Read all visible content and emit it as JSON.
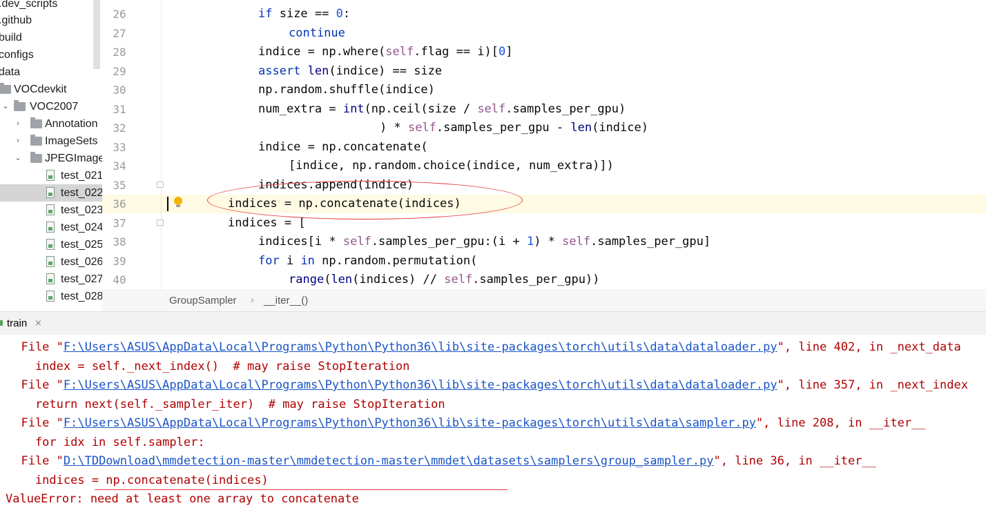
{
  "project_tree": {
    "items": [
      {
        "label": ".dev_scripts",
        "type": "folder",
        "arrow": ""
      },
      {
        "label": ".github",
        "type": "folder",
        "arrow": ""
      },
      {
        "label": "build",
        "type": "folder",
        "arrow": ""
      },
      {
        "label": "configs",
        "type": "folder",
        "arrow": ""
      },
      {
        "label": "data",
        "type": "folder",
        "arrow": ""
      },
      {
        "label": "VOCdevkit",
        "type": "folder",
        "arrow": ""
      },
      {
        "label": "VOC2007",
        "type": "folder",
        "arrow": "expanded"
      },
      {
        "label": "Annotation",
        "type": "folder",
        "arrow": "collapsed"
      },
      {
        "label": "ImageSets",
        "type": "folder",
        "arrow": "collapsed"
      },
      {
        "label": "JPEGImages",
        "type": "folder",
        "arrow": "expanded"
      },
      {
        "label": "test_021",
        "type": "file"
      },
      {
        "label": "test_022",
        "type": "file",
        "selected": true
      },
      {
        "label": "test_023",
        "type": "file"
      },
      {
        "label": "test_024",
        "type": "file"
      },
      {
        "label": "test_025",
        "type": "file"
      },
      {
        "label": "test_026",
        "type": "file"
      },
      {
        "label": "test_027",
        "type": "file"
      },
      {
        "label": "test_028",
        "type": "file"
      }
    ]
  },
  "editor": {
    "line_numbers": [
      "26",
      "27",
      "28",
      "29",
      "30",
      "31",
      "32",
      "33",
      "34",
      "35",
      "36",
      "37",
      "38",
      "39",
      "40"
    ],
    "current_line": "36",
    "tokens": [
      [
        [
          "kw",
          "if"
        ],
        [
          "t",
          " size == "
        ],
        [
          "num",
          "0"
        ],
        [
          "t",
          ":"
        ]
      ],
      [
        [
          "kw",
          "continue"
        ]
      ],
      [
        [
          "t",
          "indice = np.where("
        ],
        [
          "self",
          "self"
        ],
        [
          "t",
          ".flag == i)["
        ],
        [
          "num",
          "0"
        ],
        [
          "t",
          "]"
        ]
      ],
      [
        [
          "kw",
          "assert "
        ],
        [
          "bi",
          "len"
        ],
        [
          "t",
          "(indice) == size"
        ]
      ],
      [
        [
          "t",
          "np.random.shuffle(indice)"
        ]
      ],
      [
        [
          "t",
          "num_extra = "
        ],
        [
          "bi",
          "int"
        ],
        [
          "t",
          "(np.ceil(size / "
        ],
        [
          "self",
          "self"
        ],
        [
          "t",
          ".samples_per_gpu)"
        ]
      ],
      [
        [
          "t",
          ") * "
        ],
        [
          "self",
          "self"
        ],
        [
          "t",
          ".samples_per_gpu - "
        ],
        [
          "bi",
          "len"
        ],
        [
          "t",
          "(indice)"
        ]
      ],
      [
        [
          "t",
          "indice = np.concatenate("
        ]
      ],
      [
        [
          "t",
          "[indice, np.random.choice(indice, num_extra)])"
        ]
      ],
      [
        [
          "t",
          "indices.append(indice)"
        ]
      ],
      [
        [
          "t",
          "indices = np.concatenate(indices)"
        ]
      ],
      [
        [
          "t",
          "indices = ["
        ]
      ],
      [
        [
          "t",
          "indices[i * "
        ],
        [
          "self",
          "self"
        ],
        [
          "t",
          ".samples_per_gpu:(i + "
        ],
        [
          "num",
          "1"
        ],
        [
          "t",
          ") * "
        ],
        [
          "self",
          "self"
        ],
        [
          "t",
          ".samples_per_gpu]"
        ]
      ],
      [
        [
          "kw",
          "for "
        ],
        [
          "t",
          "i "
        ],
        [
          "kw",
          "in "
        ],
        [
          "t",
          "np.random.permutation("
        ]
      ],
      [
        [
          "bi",
          "range"
        ],
        [
          "t",
          "("
        ],
        [
          "bi",
          "len"
        ],
        [
          "t",
          "(indices) // "
        ],
        [
          "self",
          "self"
        ],
        [
          "t",
          ".samples_per_gpu))"
        ]
      ]
    ]
  },
  "breadcrumb": {
    "class_name": "GroupSampler",
    "separator": "›",
    "method_name": "__iter__()"
  },
  "run_panel": {
    "tab_label": "train",
    "tab_close": "×"
  },
  "console": {
    "lines": [
      {
        "prefix": "  File \"",
        "link": "F:\\Users\\ASUS\\AppData\\Local\\Programs\\Python\\Python36\\lib\\site-packages\\torch\\utils\\data\\dataloader.py",
        "suffix": "\", line 402, in _next_data"
      },
      {
        "text": "    index = self._next_index()  # may raise StopIteration"
      },
      {
        "prefix": "  File \"",
        "link": "F:\\Users\\ASUS\\AppData\\Local\\Programs\\Python\\Python36\\lib\\site-packages\\torch\\utils\\data\\dataloader.py",
        "suffix": "\", line 357, in _next_index"
      },
      {
        "text": "    return next(self._sampler_iter)  # may raise StopIteration"
      },
      {
        "prefix": "  File \"",
        "link": "F:\\Users\\ASUS\\AppData\\Local\\Programs\\Python\\Python36\\lib\\site-packages\\torch\\utils\\data\\sampler.py",
        "suffix": "\", line 208, in __iter__"
      },
      {
        "text": "    for idx in self.sampler:"
      },
      {
        "prefix": "  File \"",
        "link": "D:\\TDDownload\\mmdetection-master\\mmdetection-master\\mmdet\\datasets\\samplers\\group_sampler.py",
        "suffix": "\", line 36, in __iter__"
      },
      {
        "text": "    indices = np.concatenate(indices)"
      },
      {
        "text": "ValueError: need at least one array to concatenate"
      }
    ]
  },
  "colors": {
    "keyword": "#0033b3",
    "number": "#1750eb",
    "self": "#94558d",
    "builtin": "#000080",
    "console_error": "#b00000",
    "console_link": "#1a55c4",
    "annotation_red": "#e23a3a",
    "current_line_bg": "#fffae3"
  }
}
